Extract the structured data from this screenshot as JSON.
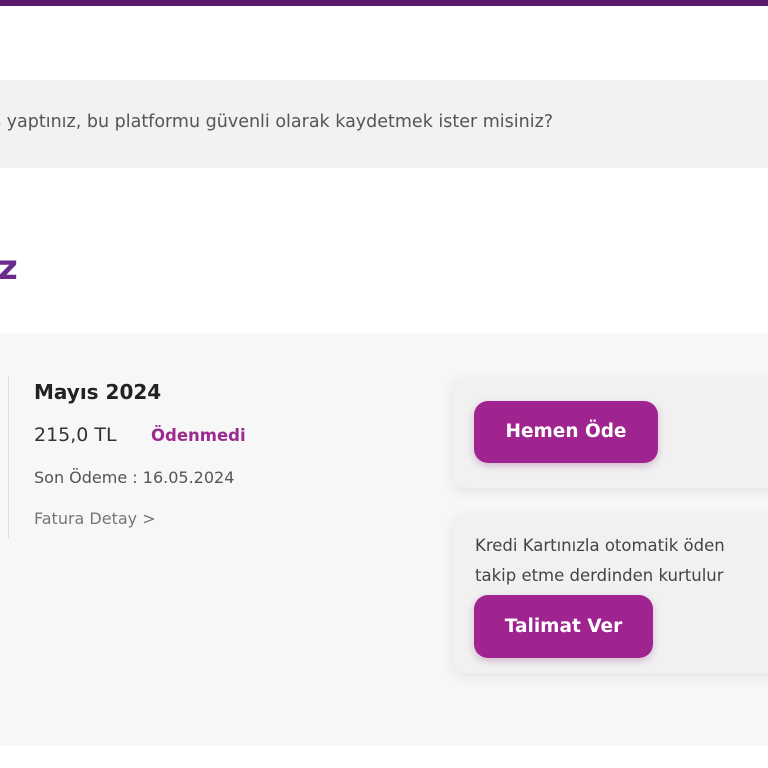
{
  "notice": {
    "text": "ş yaptınız, bu platformu güvenli olarak kaydetmek ister misiniz?"
  },
  "heading": {
    "fragment": "z"
  },
  "bill": {
    "title": "Mayıs 2024",
    "amount": "215,0 TL",
    "status": "Ödenmedi",
    "due": "Son Ödeme : 16.05.2024",
    "detail_link": "Fatura Detay >"
  },
  "pay_card": {
    "button_label": "Hemen Öde"
  },
  "auto_card": {
    "text_line1": "Kredi Kartınızla otomatik öden",
    "text_line2": "takip etme derdinden kurtulur",
    "button_label": "Talimat Ver"
  },
  "colors": {
    "accent": "#a0248f",
    "topbar": "#5a1a6e",
    "heading": "#6a2a8e"
  }
}
